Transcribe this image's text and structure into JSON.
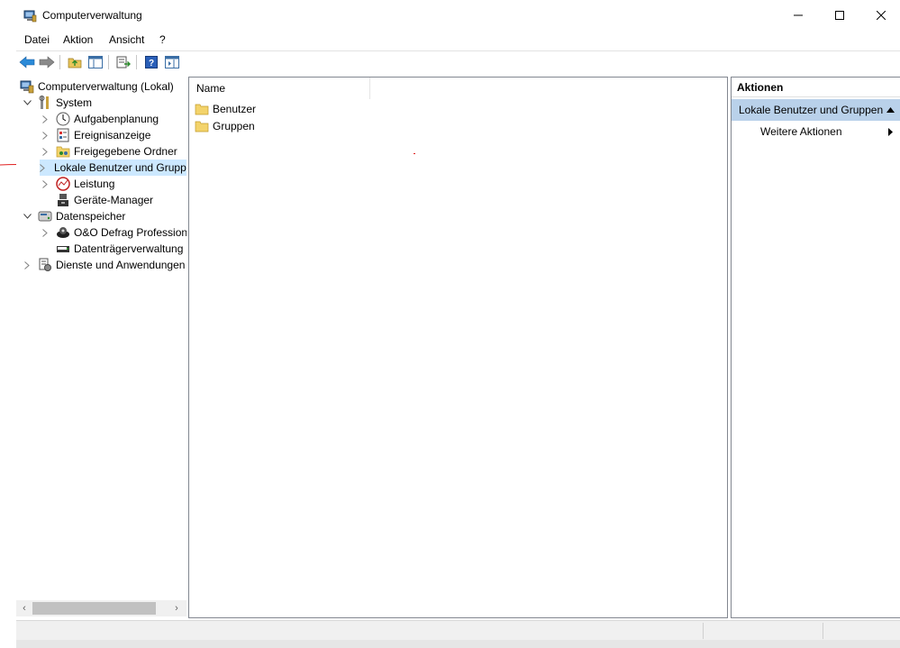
{
  "window": {
    "title": "Computerverwaltung"
  },
  "menubar": {
    "items": [
      "Datei",
      "Aktion",
      "Ansicht",
      "?"
    ]
  },
  "tree": [
    {
      "label": "Computerverwaltung (Lokal)",
      "indent": 0,
      "expander": "none",
      "icon": "computer-management-icon"
    },
    {
      "label": "System",
      "indent": 1,
      "expander": "expanded",
      "icon": "system-tools-icon"
    },
    {
      "label": "Aufgabenplanung",
      "indent": 2,
      "expander": "collapsed",
      "icon": "task-scheduler-icon"
    },
    {
      "label": "Ereignisanzeige",
      "indent": 2,
      "expander": "collapsed",
      "icon": "event-viewer-icon"
    },
    {
      "label": "Freigegebene Ordner",
      "indent": 2,
      "expander": "collapsed",
      "icon": "shared-folders-icon"
    },
    {
      "label": "Lokale Benutzer und Gruppen",
      "indent": 2,
      "expander": "collapsed",
      "icon": "local-users-groups-icon",
      "selected": true
    },
    {
      "label": "Leistung",
      "indent": 2,
      "expander": "collapsed",
      "icon": "performance-icon"
    },
    {
      "label": "Geräte-Manager",
      "indent": 2,
      "expander": "none",
      "icon": "device-manager-icon"
    },
    {
      "label": "Datenspeicher",
      "indent": 1,
      "expander": "expanded",
      "icon": "storage-icon"
    },
    {
      "label": "O&O Defrag Professional",
      "indent": 2,
      "expander": "collapsed",
      "icon": "defrag-icon"
    },
    {
      "label": "Datenträgerverwaltung",
      "indent": 2,
      "expander": "none",
      "icon": "disk-management-icon"
    },
    {
      "label": "Dienste und Anwendungen",
      "indent": 1,
      "expander": "collapsed",
      "icon": "services-icon"
    }
  ],
  "list": {
    "column_header": "Name",
    "items": [
      "Benutzer",
      "Gruppen"
    ]
  },
  "actions": {
    "header": "Aktionen",
    "section": "Lokale Benutzer und Gruppen",
    "more": "Weitere Aktionen"
  },
  "colors": {
    "selection": "#cce8ff",
    "action_section": "#b9d1ea",
    "annotation": "#e02020"
  }
}
